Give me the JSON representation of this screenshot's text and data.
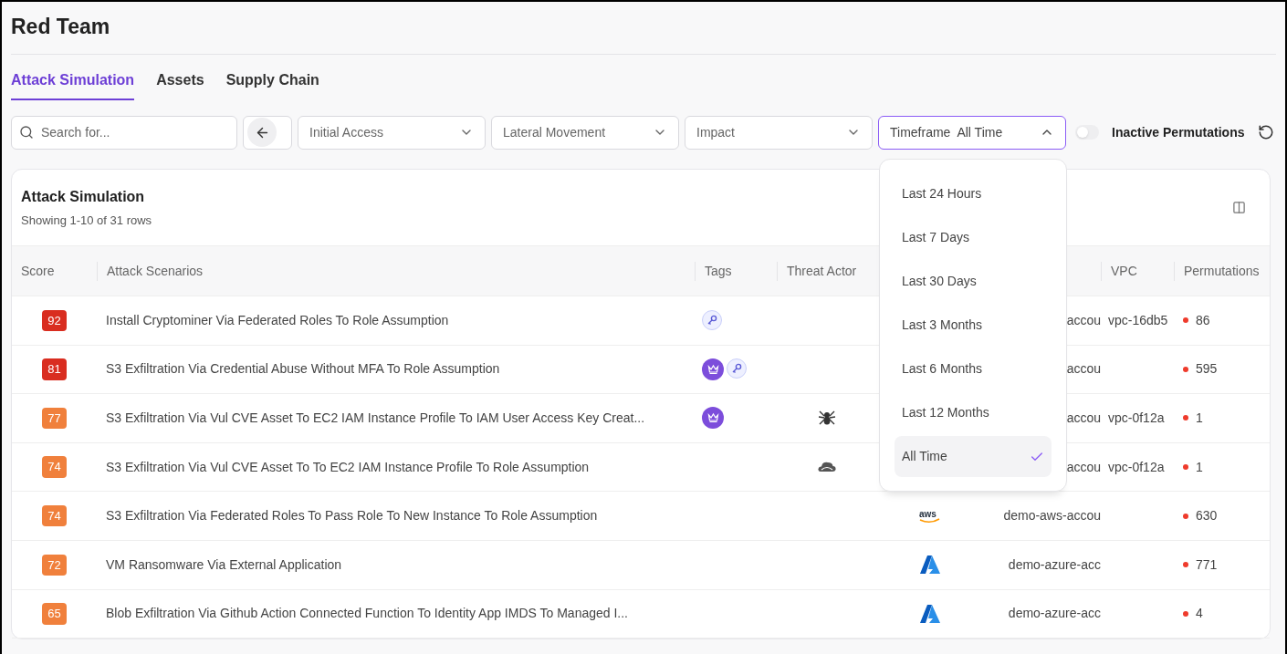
{
  "page_title": "Red Team",
  "tabs": [
    {
      "label": "Attack Simulation",
      "selected": true
    },
    {
      "label": "Assets",
      "selected": false
    },
    {
      "label": "Supply Chain",
      "selected": false
    }
  ],
  "filters": {
    "search": {
      "placeholder": "Search for..."
    },
    "dropdowns": [
      {
        "label": "Initial Access"
      },
      {
        "label": "Lateral Movement"
      },
      {
        "label": "Impact"
      }
    ],
    "timeframe": {
      "label": "Timeframe",
      "value": "All Time",
      "expanded": true,
      "options": [
        {
          "label": "Last 24 Hours",
          "selected": false
        },
        {
          "label": "Last 7 Days",
          "selected": false
        },
        {
          "label": "Last 30 Days",
          "selected": false
        },
        {
          "label": "Last 3 Months",
          "selected": false
        },
        {
          "label": "Last 6 Months",
          "selected": false
        },
        {
          "label": "Last 12 Months",
          "selected": false
        },
        {
          "label": "All Time",
          "selected": true
        }
      ]
    },
    "inactive_toggle": {
      "label": "Inactive Permutations",
      "on": false
    }
  },
  "table": {
    "title": "Attack Simulation",
    "subtitle": "Showing 1-10 of 31 rows",
    "columns": [
      "Score",
      "Attack Scenarios",
      "Tags",
      "Threat Actor",
      "VPC",
      "Permutations"
    ],
    "rows": [
      {
        "score": "92",
        "color": "#d92d20",
        "scenario": "Install Cryptominer Via Federated Roles To Role Assumption",
        "tags": [
          {
            "kind": "key"
          }
        ],
        "account": "accou",
        "vpc": "vpc-16db5",
        "permutations": "86"
      },
      {
        "score": "81",
        "color": "#d92d20",
        "scenario": "S3 Exfiltration Via Credential Abuse Without MFA To Role Assumption",
        "tags": [
          {
            "kind": "crown"
          },
          {
            "kind": "key"
          }
        ],
        "account": "accou",
        "permutations": "595"
      },
      {
        "score": "77",
        "color": "#f0803c",
        "scenario": "S3 Exfiltration Via Vul CVE Asset To EC2 IAM Instance Profile To IAM User Access Key Creat...",
        "tags": [
          {
            "kind": "crown"
          }
        ],
        "threat_actor": {
          "kind": "spider"
        },
        "account": "accou",
        "vpc": "vpc-0f12a",
        "permutations": "1"
      },
      {
        "score": "74",
        "color": "#f0803c",
        "scenario": "S3 Exfiltration Via Vul CVE Asset To To EC2 IAM Instance Profile To Role Assumption",
        "threat_actor": {
          "kind": "cloud"
        },
        "account": "accou",
        "vpc": "vpc-0f12a",
        "permutations": "1"
      },
      {
        "score": "74",
        "color": "#f0803c",
        "scenario": "S3 Exfiltration Via Federated Roles To Pass Role To New Instance To Role Assumption",
        "provider": {
          "kind": "aws"
        },
        "account": "demo-aws-accou",
        "permutations": "630"
      },
      {
        "score": "72",
        "color": "#f0803c",
        "scenario": "VM Ransomware Via External Application",
        "provider": {
          "kind": "azure"
        },
        "account": "demo-azure-acc",
        "permutations": "771"
      },
      {
        "score": "65",
        "color": "#f0803c",
        "scenario": "Blob Exfiltration Via Github Action Connected Function To Identity App IMDS To Managed I...",
        "provider": {
          "kind": "azure"
        },
        "account": "demo-azure-acc",
        "permutations": "4"
      }
    ]
  }
}
